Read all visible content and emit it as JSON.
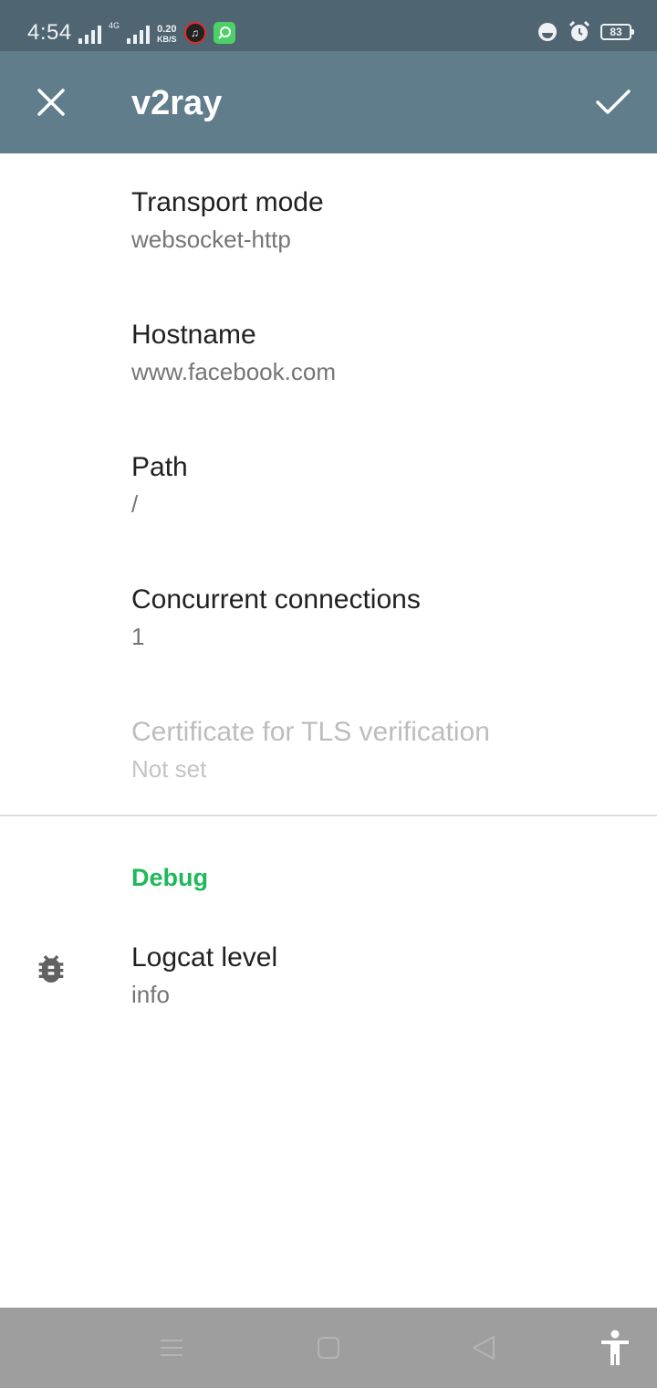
{
  "status_bar": {
    "time": "4:54",
    "network_type": "4G",
    "speed_value": "0.20",
    "speed_unit": "KB/S",
    "battery": "83",
    "icons": [
      "signal-icon",
      "signal-4g-icon",
      "music-icon",
      "app-notification-icon",
      "data-saver-icon",
      "alarm-icon",
      "battery-icon"
    ]
  },
  "app_bar": {
    "title": "v2ray",
    "close_icon": "close-icon",
    "confirm_icon": "check-icon",
    "background_color": "#607d8b"
  },
  "preferences": [
    {
      "title": "Transport mode",
      "summary": "websocket-http",
      "enabled": true
    },
    {
      "title": "Hostname",
      "summary": "www.facebook.com",
      "enabled": true
    },
    {
      "title": "Path",
      "summary": "/",
      "enabled": true
    },
    {
      "title": "Concurrent connections",
      "summary": "1",
      "enabled": true
    },
    {
      "title": "Certificate for TLS verification",
      "summary": "Not set",
      "enabled": false
    }
  ],
  "debug_section": {
    "category_title": "Debug",
    "accent_color": "#1fb85a",
    "logcat": {
      "title": "Logcat level",
      "summary": "info",
      "icon": "bug-icon"
    }
  },
  "nav_bar": {
    "icons": [
      "menu-icon",
      "home-icon",
      "back-icon",
      "accessibility-icon"
    ]
  }
}
